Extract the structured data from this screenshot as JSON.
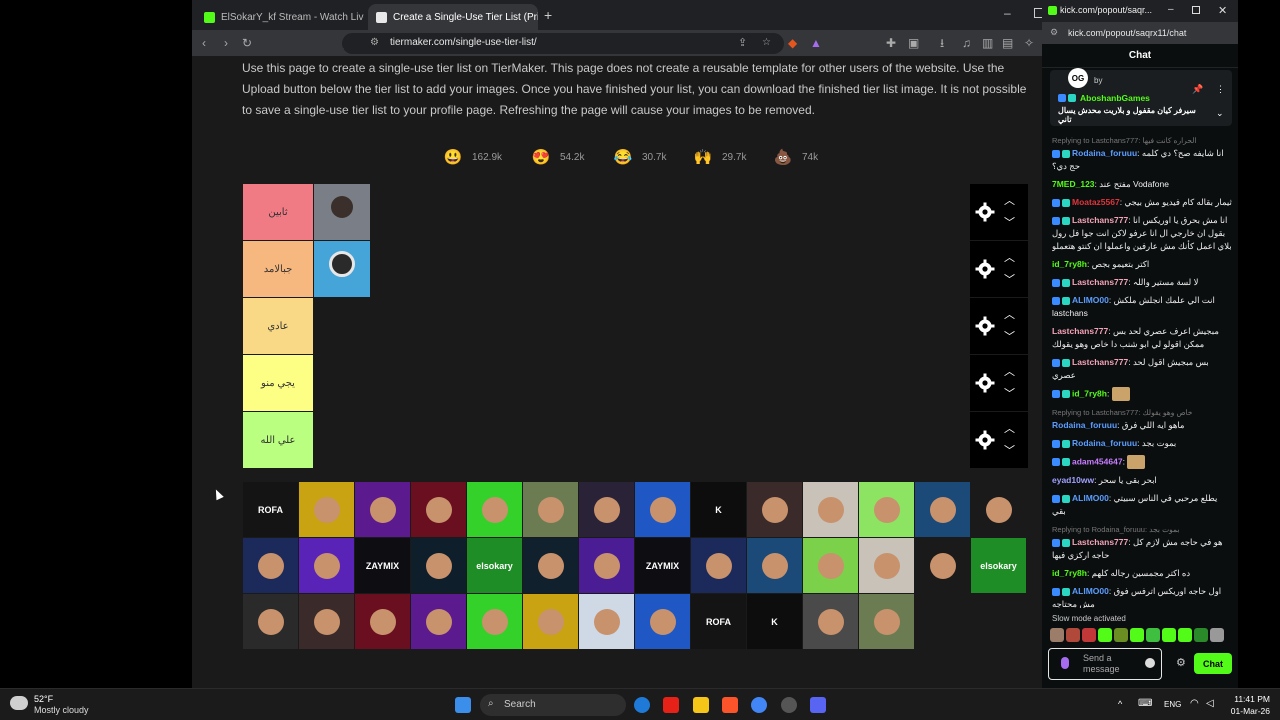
{
  "browser": {
    "tabs": [
      {
        "title": "ElSokarY_kf Stream - Watch Live on K",
        "favicon_color": "#53fc18"
      },
      {
        "title": "Create a Single-Use Tier List (Pri",
        "favicon_color": "#e8e8e8"
      }
    ],
    "url": "tiermaker.com/single-use-tier-list/"
  },
  "page": {
    "intro": "Use this page to create a single-use tier list on TierMaker. This page does not create a reusable template for other users of the website. Use the Upload button below the tier list to add your images. Once you have finished your list, you can download the finished tier list image. It is not possible to save a single-use tier list to your profile page. Refreshing the page will cause your images to be removed.",
    "reactions": [
      {
        "emoji": "😃",
        "count": "162.9k"
      },
      {
        "emoji": "😍",
        "count": "54.2k"
      },
      {
        "emoji": "😂",
        "count": "30.7k"
      },
      {
        "emoji": "🙌",
        "count": "29.7k"
      },
      {
        "emoji": "💩",
        "count": "74k"
      }
    ],
    "tiers": [
      {
        "label": "ثابين",
        "color": "#f07b85"
      },
      {
        "label": "جبالامد",
        "color": "#f7b87f"
      },
      {
        "label": "عادي",
        "color": "#f9d986"
      },
      {
        "label": "يجي منو",
        "color": "#fdff85"
      },
      {
        "label": "علي الله",
        "color": "#baff80"
      }
    ],
    "pool_thumbs": [
      {
        "label": "ROFA",
        "bg": "#141414"
      },
      {
        "label": "",
        "bg": "#c9a311"
      },
      {
        "label": "",
        "bg": "#5b1a8e"
      },
      {
        "label": "",
        "bg": "#6a0f1f"
      },
      {
        "label": "",
        "bg": "#33d12a"
      },
      {
        "label": "",
        "bg": "#6b7c52"
      },
      {
        "label": "",
        "bg": "#2a2236"
      },
      {
        "label": "",
        "bg": "#1f57c5"
      },
      {
        "label": "K",
        "bg": "#0d0d0d"
      },
      {
        "label": "",
        "bg": "#3a2a2a"
      },
      {
        "label": "",
        "bg": "#c8c2b8"
      },
      {
        "label": "",
        "bg": "#8de362"
      },
      {
        "label": "",
        "bg": "#1b4a78"
      },
      {
        "label": "",
        "bg": "#1a1a1a"
      },
      {
        "label": "",
        "bg": "#1b2a5a"
      },
      {
        "label": "",
        "bg": "#5a23b8"
      },
      {
        "label": "ZAYMIX",
        "bg": "#0d0d12"
      },
      {
        "label": "",
        "bg": "#0e1e2a"
      },
      {
        "label": "elsokary",
        "bg": "#1f8d25"
      },
      {
        "label": "",
        "bg": "#10202c"
      },
      {
        "label": "",
        "bg": "#4b1d94"
      },
      {
        "label": "ZAYMIX",
        "bg": "#0d0d12"
      },
      {
        "label": "",
        "bg": "#1b2a5a"
      },
      {
        "label": "",
        "bg": "#1b4a78"
      },
      {
        "label": "",
        "bg": "#7bd14a"
      },
      {
        "label": "",
        "bg": "#c8c2b8"
      },
      {
        "label": "",
        "bg": "#1a1a1a"
      },
      {
        "label": "elsokary",
        "bg": "#1f8d25"
      },
      {
        "label": "",
        "bg": "#2a2a2a"
      },
      {
        "label": "",
        "bg": "#3a2a2a"
      },
      {
        "label": "",
        "bg": "#6a0f1f"
      },
      {
        "label": "",
        "bg": "#5b1a8e"
      },
      {
        "label": "",
        "bg": "#33d12a"
      },
      {
        "label": "",
        "bg": "#c9a311"
      },
      {
        "label": "",
        "bg": "#cfd9e6"
      },
      {
        "label": "",
        "bg": "#1f57c5"
      },
      {
        "label": "ROFA",
        "bg": "#141414"
      },
      {
        "label": "K",
        "bg": "#0d0d0d"
      },
      {
        "label": "",
        "bg": "#4a4a4a"
      },
      {
        "label": "",
        "bg": "#6b7c52"
      }
    ]
  },
  "chat": {
    "window_title": "kick.com/popout/saqr...",
    "address": "kick.com/popout/saqrx11/chat",
    "header": "Chat",
    "pinned_by": "by",
    "pinned_user": "AboshanbGames",
    "pinned_text": "سيرفر كيان مقفول و بلاريت محدش يسال تاني",
    "messages": [
      {
        "reply": "Replying to Lastchans777: الحراره كانت فيها",
        "user": "Rodaina_foruuu",
        "color": "#5b9dff",
        "text": "انا شايفه صح؟ دي كلمه حج دي؟"
      },
      {
        "reply": "",
        "user": "7MED_123",
        "color": "#53fc18",
        "text": "مفتح عند Vodafone"
      },
      {
        "reply": "",
        "user": "Moataz5567",
        "color": "#e0343c",
        "text": "ثيمار بقاله كام فيديو مش بيجي"
      },
      {
        "reply": "",
        "user": "Lastchans777",
        "color": "#f5a3b8",
        "text": "انا مش بحرق يا اوريكس انا بقول ان خارجي ال انا عرفو لاكن انت جوا فل رول بلاي اعمل كأنك مش عارفين واعملوا ان كنتو هتعملو"
      },
      {
        "reply": "",
        "user": "id_7ry8h",
        "color": "#53fc18",
        "text": "اكتر بتعيمو بجص"
      },
      {
        "reply": "",
        "user": "Lastchans777",
        "color": "#f5a3b8",
        "text": "لا لسة مستير واللہ"
      },
      {
        "reply": "",
        "user": "ALIMO00",
        "color": "#5b9dff",
        "text": "انت الي علمك انجلش ملكش lastchans"
      },
      {
        "reply": "",
        "user": "Lastchans777",
        "color": "#f5a3b8",
        "text": "مبجيش اعرف عصري لحد بس ممكن اقولو لي ابو شنب دا خاص وهو يقولك"
      },
      {
        "reply": "",
        "user": "Lastchans777",
        "color": "#f5a3b8",
        "text": "بس مبجيش اقول لحد عصري"
      },
      {
        "reply": "",
        "user": "id_7ry8h",
        "color": "#53fc18",
        "text": ""
      },
      {
        "reply": "Replying to Lastchans777: خاص وهو يقولك",
        "user": "Rodaina_foruuu",
        "color": "#5b9dff",
        "text": "ماهو ايه اللي فرق"
      },
      {
        "reply": "",
        "user": "Rodaina_foruuu",
        "color": "#5b9dff",
        "text": "بموت بجد"
      },
      {
        "reply": "",
        "user": "adam454647",
        "color": "#c77dff",
        "text": ""
      },
      {
        "reply": "",
        "user": "eyad10ww",
        "color": "#a0a0ff",
        "text": "ابحر بقى يا سحر"
      },
      {
        "reply": "",
        "user": "ALIMO00",
        "color": "#5b9dff",
        "text": "يطلع مرحبي في الناس سبيتي بقي"
      },
      {
        "reply": "Replying to Rodaina_foruuu: بموت بجد",
        "user": "Lastchans777",
        "color": "#f5a3b8",
        "text": "هو في حاجه مش لازم كل حاجه اركزي فيها"
      },
      {
        "reply": "",
        "user": "id_7ry8h",
        "color": "#53fc18",
        "text": "ده اكتر مجمسين رجاله كلهم"
      },
      {
        "reply": "",
        "user": "ALIMO00",
        "color": "#5b9dff",
        "text": "اول حاجه اوريكس اترفس فوق مش محتاجه"
      }
    ],
    "slow_mode": "Slow mode activated",
    "input_placeholder": "Send a message",
    "send_label": "Chat"
  },
  "taskbar": {
    "weather_temp": "52°F",
    "weather_desc": "Mostly cloudy",
    "search_label": "Search",
    "lang": "ENG",
    "time": "11:41 PM",
    "date": "01-Mar-26"
  }
}
